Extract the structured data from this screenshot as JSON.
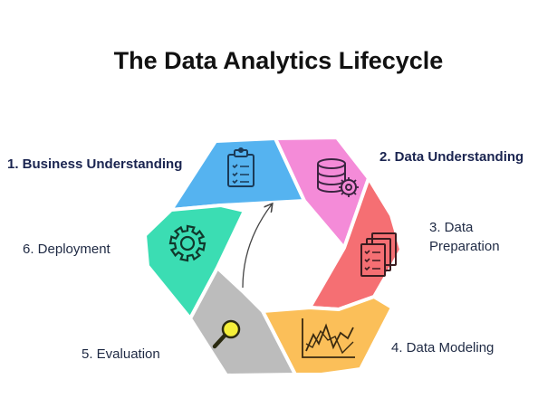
{
  "title": "The Data Analytics Lifecycle",
  "stages": [
    {
      "label": "1. Business Understanding",
      "color": "#55b3f0",
      "icon": "clipboard-icon",
      "emphasis": true
    },
    {
      "label": "2. Data Understanding",
      "color": "#f48bd8",
      "icon": "database-gear-icon",
      "emphasis": true
    },
    {
      "label": "3. Data Preparation",
      "line1": "3. Data",
      "line2": "Preparation",
      "color": "#f56f73",
      "icon": "documents-checklist-icon",
      "emphasis": false
    },
    {
      "label": "4. Data Modeling",
      "color": "#fbbf59",
      "icon": "line-chart-icon",
      "emphasis": false
    },
    {
      "label": "5. Evaluation",
      "color": "#bcbcbc",
      "icon": "magnifier-icon",
      "emphasis": false
    },
    {
      "label": "6. Deployment",
      "color": "#3bddb3",
      "icon": "gear-icon",
      "emphasis": false
    }
  ]
}
